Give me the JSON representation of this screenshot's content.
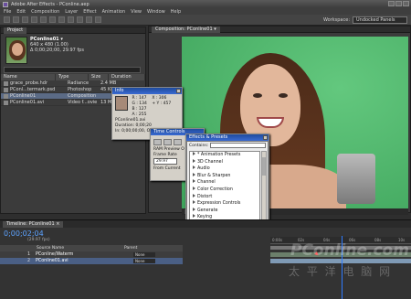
{
  "window": {
    "title": "Adobe After Effects - PConline.aep"
  },
  "menu": [
    "File",
    "Edit",
    "Composition",
    "Layer",
    "Effect",
    "Animation",
    "View",
    "Window",
    "Help"
  ],
  "workspace": {
    "label": "Workspace:",
    "value": "Undocked Panels"
  },
  "project": {
    "tab": "Project",
    "comp_name": "PConline01 ▾",
    "comp_size": "640 x 480 (1.00)",
    "comp_dur": "Δ 0;00;20;00, 29.97 fps",
    "columns": [
      "Name",
      "Type",
      "Size",
      "Duration"
    ],
    "items": [
      {
        "name": "grace_probe.hdr",
        "type": "Radiance",
        "size": "2.4 MB"
      },
      {
        "name": "PConl...termark.psd",
        "type": "Photoshop",
        "size": "45 KB"
      },
      {
        "name": "PConline01",
        "type": "Composition",
        "size": ""
      },
      {
        "name": "PConline01.avi",
        "type": "Video f...ovie",
        "size": "13 MB"
      }
    ]
  },
  "composition": {
    "tab": "Composition: PConline01 ▾",
    "footer": [
      "Active Camera",
      "1 View"
    ]
  },
  "info": {
    "title": "Info",
    "r": "R : 147",
    "g": "G : 134",
    "b": "B : 127",
    "a": "A : 255",
    "x": "X : 306",
    "y": "+ Y : 457",
    "file": "PConline01.avi",
    "duration": "Duration: 0;00;20",
    "inout": "In: 0;00;00;00, Out:"
  },
  "time_controls": {
    "title": "Time Controls",
    "ram_preview": "RAM Preview O",
    "frame_rate_label": "Frame Rate",
    "frame_rate_value": "29.97",
    "from_current": "From Current"
  },
  "effects": {
    "title": "Effects & Presets",
    "contains_label": "Contains:",
    "items": [
      "* Animation Presets",
      "3D Channel",
      "Audio",
      "Blur & Sharpen",
      "Channel",
      "Color Correction",
      "Distort",
      "Expression Controls",
      "Generate",
      "Keying",
      "Matte",
      "Noise & Grain",
      "Paint",
      "Perspective"
    ]
  },
  "timeline": {
    "tab": "Timeline: PConline01 ×",
    "timecode": "0;00;02;04",
    "fps": "(29.97 fps)",
    "header": [
      "Source Name",
      "Parent"
    ],
    "layers": [
      {
        "num": "1",
        "name": "PConline/Waterm",
        "parent": "None"
      },
      {
        "num": "2",
        "name": "PConline01.avi",
        "parent": "None"
      }
    ],
    "ruler": [
      "0:00s",
      "02s",
      "04s",
      "06s",
      "08s",
      "10s"
    ]
  },
  "watermark": {
    "text1": "PConline.com",
    "text2": "太 平 洋 电 脑 网"
  }
}
